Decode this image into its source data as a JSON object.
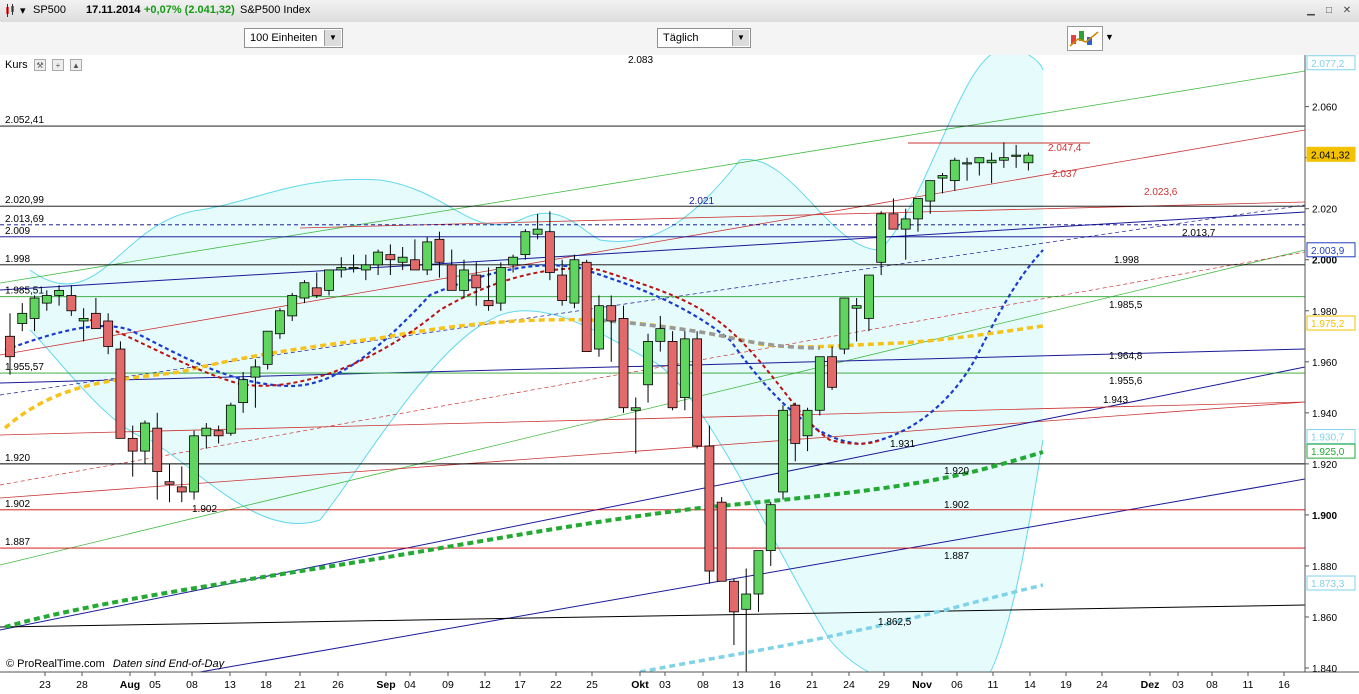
{
  "window": {
    "symbol": "SP500",
    "date": "17.11.2014",
    "change": "+0,07% (2.041,32)",
    "name": "S&P500 Index"
  },
  "toolbar": {
    "units_value": "100 Einheiten",
    "period_value": "Täglich"
  },
  "panel": {
    "label": "Kurs"
  },
  "footer": {
    "copyright": "© ProRealTime.com",
    "note": "Daten sind End-of-Day"
  },
  "chart_data": {
    "type": "candlestick",
    "ylim": [
      1836,
      2090
    ],
    "y_ticks": [
      "2.060",
      "2.040",
      "2.020",
      "2.000",
      "1.980",
      "1.960",
      "1.940",
      "1.920",
      "1.900",
      "1.880",
      "1.860",
      "1.840"
    ],
    "x_ticks": [
      "23",
      "28",
      "Aug",
      "05",
      "08",
      "13",
      "18",
      "21",
      "26",
      "Sep",
      "04",
      "09",
      "12",
      "17",
      "22",
      "25",
      "Okt",
      "03",
      "08",
      "13",
      "16",
      "21",
      "24",
      "29",
      "Nov",
      "06",
      "11",
      "14",
      "19",
      "24",
      "Dez",
      "03",
      "08",
      "11",
      "16"
    ],
    "candles": [
      [
        1970,
        1979,
        1955,
        1962
      ],
      [
        1975,
        1983,
        1972,
        1979
      ],
      [
        1977,
        1986,
        1972,
        1985
      ],
      [
        1983,
        1988,
        1980,
        1986
      ],
      [
        1986,
        1990,
        1982,
        1988
      ],
      [
        1986,
        1990,
        1978,
        1980
      ],
      [
        1976,
        1981,
        1968,
        1977
      ],
      [
        1979,
        1985,
        1975,
        1973
      ],
      [
        1976,
        1979,
        1963,
        1966
      ],
      [
        1965,
        1968,
        1930,
        1930
      ],
      [
        1930,
        1935,
        1915,
        1925
      ],
      [
        1925,
        1937,
        1920,
        1936
      ],
      [
        1934,
        1940,
        1906,
        1917
      ],
      [
        1913,
        1920,
        1905,
        1912
      ],
      [
        1911,
        1919,
        1905,
        1909
      ],
      [
        1909,
        1933,
        1906,
        1931
      ],
      [
        1931,
        1936,
        1926,
        1934
      ],
      [
        1933,
        1935,
        1928,
        1931
      ],
      [
        1932,
        1944,
        1931,
        1943
      ],
      [
        1944,
        1956,
        1940,
        1953
      ],
      [
        1954,
        1961,
        1942,
        1958
      ],
      [
        1959,
        1972,
        1957,
        1972
      ],
      [
        1971,
        1981,
        1969,
        1980
      ],
      [
        1978,
        1987,
        1976,
        1986
      ],
      [
        1985,
        1992,
        1983,
        1991
      ],
      [
        1989,
        1995,
        1985,
        1986
      ],
      [
        1988,
        1994,
        1986,
        1996
      ],
      [
        1996,
        2001,
        1993,
        1997
      ],
      [
        1997,
        2002,
        1995,
        1997
      ],
      [
        1996,
        2002,
        1992,
        1998
      ],
      [
        1998,
        2004,
        1994,
        2003
      ],
      [
        2002,
        2006,
        1994,
        2000
      ],
      [
        1999,
        2005,
        1996,
        2001
      ],
      [
        2000,
        2008,
        1996,
        1996
      ],
      [
        1996,
        2009,
        1994,
        2007
      ],
      [
        2008,
        2011,
        1993,
        1999
      ],
      [
        1998,
        2004,
        1992,
        1988
      ],
      [
        1988,
        2000,
        1985,
        1996
      ],
      [
        1994,
        1999,
        1982,
        1989
      ],
      [
        1984,
        1997,
        1980,
        1982
      ],
      [
        1983,
        1999,
        1980,
        1997
      ],
      [
        1998,
        2002,
        1995,
        2001
      ],
      [
        2002,
        2012,
        2000,
        2011
      ],
      [
        2010,
        2018,
        2008,
        2012
      ],
      [
        2011,
        2019,
        1992,
        1995
      ],
      [
        1994,
        2000,
        1982,
        1984
      ],
      [
        1983,
        2002,
        1981,
        2000
      ],
      [
        1999,
        2000,
        1968,
        1964
      ],
      [
        1965,
        1986,
        1962,
        1982
      ],
      [
        1982,
        1986,
        1960,
        1976
      ],
      [
        1977,
        1982,
        1940,
        1942
      ],
      [
        1941,
        1946,
        1924,
        1942
      ],
      [
        1951,
        1971,
        1944,
        1968
      ],
      [
        1968,
        1978,
        1964,
        1973
      ],
      [
        1968,
        1972,
        1941,
        1942
      ],
      [
        1946,
        1972,
        1941,
        1969
      ],
      [
        1969,
        1972,
        1926,
        1927
      ],
      [
        1927,
        1935,
        1873,
        1878
      ],
      [
        1905,
        1907,
        1874,
        1874
      ],
      [
        1874,
        1875,
        1849,
        1862
      ],
      [
        1863,
        1879,
        1836,
        1869
      ],
      [
        1869,
        1878,
        1862,
        1886
      ],
      [
        1886,
        1905,
        1880,
        1904
      ],
      [
        1909,
        1943,
        1906,
        1941
      ],
      [
        1943,
        1944,
        1921,
        1928
      ],
      [
        1931,
        1942,
        1925,
        1941
      ],
      [
        1941,
        1962,
        1939,
        1962
      ],
      [
        1962,
        1966,
        1949,
        1950
      ],
      [
        1965,
        1985,
        1963,
        1985
      ],
      [
        1981,
        1985,
        1968,
        1982
      ],
      [
        1977,
        1994,
        1972,
        1994
      ],
      [
        1999,
        2019,
        1994,
        2018
      ],
      [
        2018,
        2024,
        2013,
        2012
      ],
      [
        2012,
        2020,
        2000,
        2016
      ],
      [
        2016,
        2024,
        2011,
        2024
      ],
      [
        2023,
        2030,
        2018,
        2031
      ],
      [
        2032,
        2034,
        2026,
        2033
      ],
      [
        2031,
        2040,
        2027,
        2039
      ],
      [
        2038,
        2040,
        2031,
        2038
      ],
      [
        2038,
        2040,
        2033,
        2040
      ],
      [
        2038,
        2042,
        2030,
        2039
      ],
      [
        2039,
        2046,
        2036,
        2040
      ],
      [
        2041,
        2045,
        2036,
        2041
      ],
      [
        2038,
        2042,
        2035,
        2041
      ]
    ],
    "horizontal_levels": [
      {
        "value": 2052.41,
        "label": "2.052,41",
        "color": "#000000"
      },
      {
        "value": 2020.99,
        "label": "2.020,99",
        "color": "#000000"
      },
      {
        "value": 2013.69,
        "label": "2.013,69",
        "color": "#00008b",
        "dashed": true
      },
      {
        "value": 2009,
        "label": "2.009",
        "color": "#00008b"
      },
      {
        "value": 1998,
        "label": "1.998",
        "color": "#000000"
      },
      {
        "value": 1985.51,
        "label": "1.985,51",
        "color": "#2ca02c"
      },
      {
        "value": 1955.57,
        "label": "1.955,57",
        "color": "#2ca02c"
      },
      {
        "value": 1920,
        "label": "1.920",
        "color": "#000000"
      },
      {
        "value": 1902,
        "label": "1.902",
        "color": "#cc0000"
      },
      {
        "value": 1887,
        "label": "1.887",
        "color": "#cc0000"
      }
    ],
    "chart_labels": [
      "2.083",
      "2.021",
      "2.047,4",
      "2.037",
      "2.023,6",
      "2.013,7",
      "1.998",
      "1.985,5",
      "1.964,8",
      "1.955,6",
      "1.943",
      "1.931",
      "1.920",
      "1.902",
      "1.887",
      "1.862,5"
    ],
    "axis_badges": [
      {
        "label": "2.077,2",
        "value": 2077.2,
        "color": "#7fd3e8"
      },
      {
        "label": "2.041,32",
        "value": 2041.32,
        "color": "#f2c200"
      },
      {
        "label": "2.003,9",
        "value": 2003.9,
        "color": "#1f3fbf"
      },
      {
        "label": "1.975,2",
        "value": 1975.2,
        "color": "#f2c200"
      },
      {
        "label": "1.930,7",
        "value": 1930.7,
        "color": "#7fd3e8"
      },
      {
        "label": "1.925,0",
        "value": 1925.0,
        "color": "#22aa33"
      },
      {
        "label": "1.873,3",
        "value": 1873.3,
        "color": "#7fd3e8"
      }
    ]
  }
}
